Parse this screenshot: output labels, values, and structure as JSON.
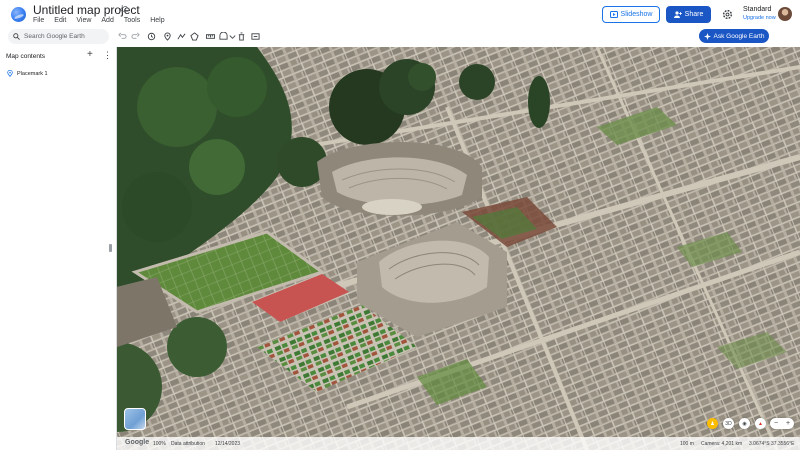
{
  "header": {
    "title": "Untitled map project",
    "menu": [
      "File",
      "Edit",
      "View",
      "Add",
      "Tools",
      "Help"
    ],
    "slideshow_label": "Slideshow",
    "share_label": "Share",
    "plan_name": "Standard",
    "plan_upgrade": "Upgrade now"
  },
  "toolbar": {
    "search_placeholder": "Search Google Earth",
    "ask_label": "Ask Google Earth",
    "tools": [
      "undo-icon",
      "redo-icon",
      "history-icon",
      "placemark-icon",
      "path-icon",
      "polygon-icon",
      "measure-icon",
      "camera-icon",
      "import-icon"
    ]
  },
  "sidepanel": {
    "title": "Map contents",
    "items": [
      {
        "label": "Placemark 1"
      }
    ]
  },
  "footer": {
    "brand": "Google",
    "zoom_pct": "100%",
    "attribution": "Data attribution",
    "date": "12/14/2023",
    "scale": "100 m",
    "camera": "Camera: 4,201 km",
    "coords": "3.0674°S 37.3556°E"
  },
  "map_controls": {
    "tilt_label": "3D",
    "zoom_in": "+",
    "zoom_out": "−"
  },
  "colors": {
    "accent": "#1a73e8",
    "share_bg": "#1a56c4",
    "map_stone": "#a8a396"
  }
}
